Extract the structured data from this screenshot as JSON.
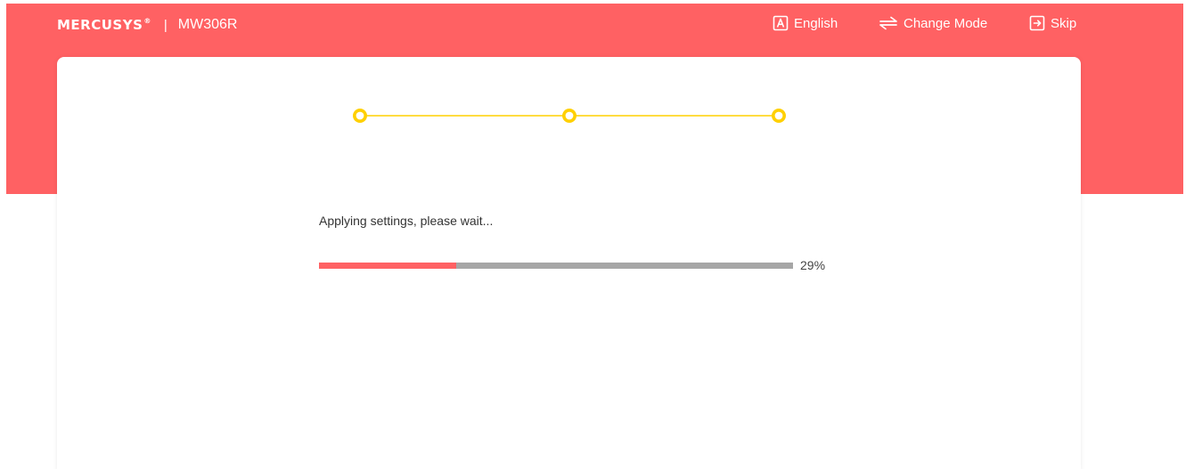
{
  "header": {
    "brand": "MERCUSYS",
    "brand_mark": "®",
    "separator": "|",
    "model": "MW306R",
    "language": {
      "icon": "language-a-icon",
      "label": "English"
    },
    "change_mode": {
      "icon": "swap-arrows-icon",
      "label": "Change Mode"
    },
    "skip": {
      "icon": "exit-arrow-icon",
      "label": "Skip"
    }
  },
  "stepper": {
    "steps": 3,
    "active_color": "#ffd000"
  },
  "main": {
    "status_text": "Applying settings, please wait...",
    "progress": {
      "value": 29,
      "label": "29%"
    }
  },
  "colors": {
    "brand": "#ff6163",
    "progress_fill": "#ff6163",
    "progress_track": "#a6a6a6",
    "stepper": "#ffd000"
  }
}
